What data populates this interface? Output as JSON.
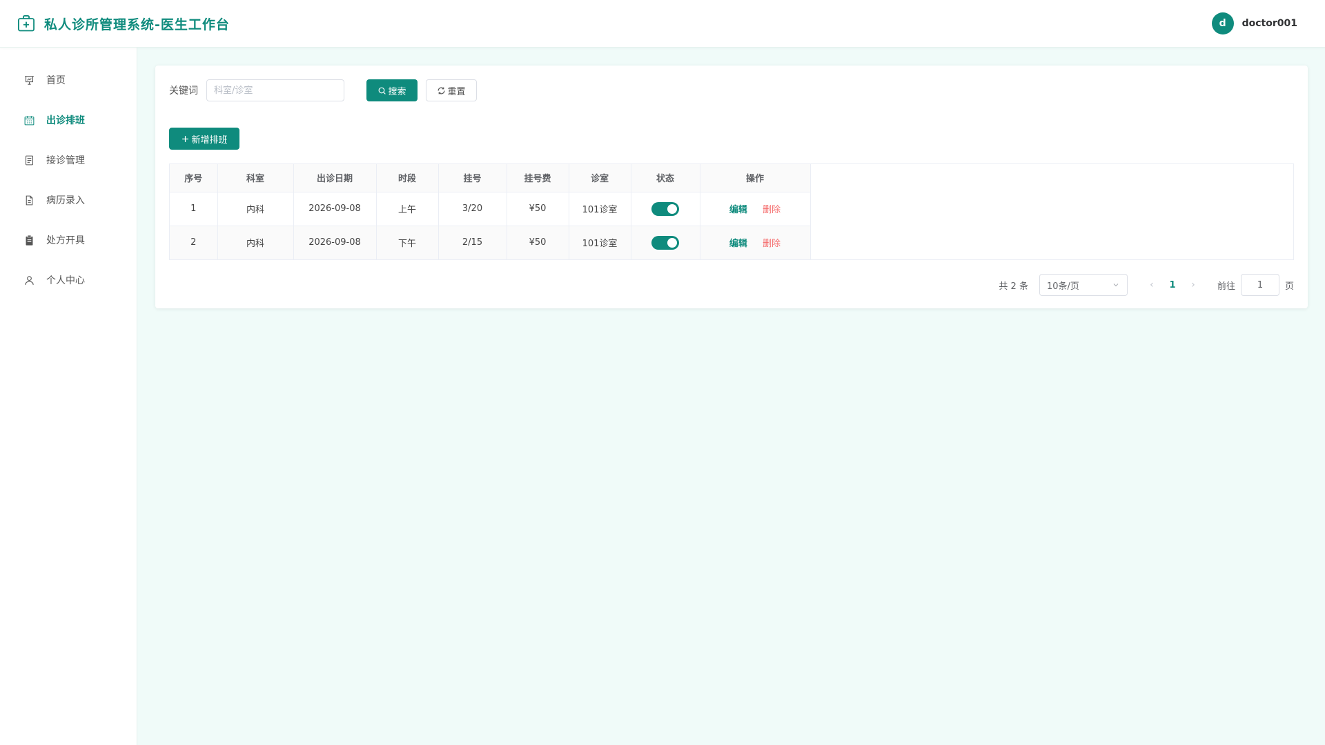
{
  "app": {
    "title": "私人诊所管理系统-医生工作台",
    "brand_icon": "medical-kit-icon",
    "accent_color": "#0f8b7d",
    "danger_color": "#f56c6c"
  },
  "user": {
    "avatar_letter": "d",
    "name": "doctor001"
  },
  "sidebar": {
    "items": [
      {
        "label": "首页",
        "icon": "dashboard-icon",
        "active": false
      },
      {
        "label": "出诊排班",
        "icon": "calendar-icon",
        "active": true
      },
      {
        "label": "接诊管理",
        "icon": "document-icon",
        "active": false
      },
      {
        "label": "病历录入",
        "icon": "file-text-icon",
        "active": false
      },
      {
        "label": "处方开具",
        "icon": "clipboard-icon",
        "active": false
      },
      {
        "label": "个人中心",
        "icon": "user-icon",
        "active": false
      }
    ]
  },
  "search": {
    "label": "关键词",
    "placeholder": "科室/诊室",
    "value": "",
    "search_label": "搜索",
    "reset_label": "重置"
  },
  "toolbar": {
    "add_label": "新增排班"
  },
  "table": {
    "columns": [
      "序号",
      "科室",
      "出诊日期",
      "时段",
      "挂号",
      "挂号费",
      "诊室",
      "状态",
      "操作"
    ],
    "rows": [
      {
        "index": "1",
        "department": "内科",
        "date": "2026-09-08",
        "period": "上午",
        "registered": "3/20",
        "fee": "¥50",
        "room": "101诊室",
        "status_on": true
      },
      {
        "index": "2",
        "department": "内科",
        "date": "2026-09-08",
        "period": "下午",
        "registered": "2/15",
        "fee": "¥50",
        "room": "101诊室",
        "status_on": true
      }
    ],
    "edit_label": "编辑",
    "delete_label": "删除"
  },
  "pagination": {
    "total_text": "共 2 条",
    "page_size": "10条/页",
    "current_page": "1",
    "goto_label": "前往",
    "goto_value": "1",
    "goto_suffix": "页"
  }
}
